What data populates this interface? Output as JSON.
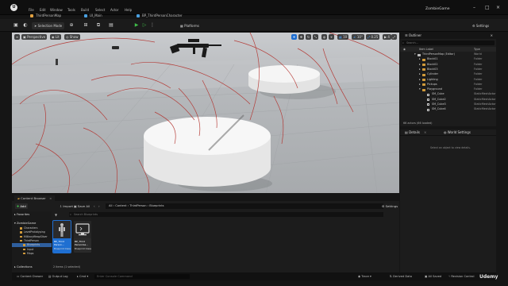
{
  "app": {
    "project_name": "ZombieGame",
    "logo_glyph": "U",
    "watermark": "Udemy"
  },
  "menu": [
    "File",
    "Edit",
    "Window",
    "Tools",
    "Build",
    "Select",
    "Actor",
    "Help"
  ],
  "tabs": [
    {
      "label": "ThirdPersonMap",
      "color": "#e0a040"
    },
    {
      "label": "UI_Main",
      "color": "#4aa0e0"
    },
    {
      "label": "BP_ThirdPersonCharacter",
      "color": "#4aa0e0"
    }
  ],
  "toolbar": {
    "selection_mode": "Selection Mode",
    "platforms": "Platforms",
    "settings": "Settings"
  },
  "viewport": {
    "perspective": "Perspective",
    "lit": "Lit",
    "show": "Show",
    "grid_snap": "10",
    "rot_snap": "10°",
    "scale_snap": "0.25",
    "cam_speed": "4"
  },
  "outliner": {
    "title": "Outliner",
    "col_label": "Item Label",
    "col_type": "Type",
    "search_placeholder": "Search...",
    "status": "66 actors (66 loaded)",
    "rows": [
      {
        "label": "ThirdPersonMap (Editor)",
        "type": "World",
        "indent": 0,
        "icon": "world"
      },
      {
        "label": "Block01",
        "type": "Folder",
        "indent": 1,
        "icon": "folder"
      },
      {
        "label": "Block02",
        "type": "Folder",
        "indent": 1,
        "icon": "folder"
      },
      {
        "label": "Block03",
        "type": "Folder",
        "indent": 1,
        "icon": "folder"
      },
      {
        "label": "Cylinder",
        "type": "Folder",
        "indent": 1,
        "icon": "folder"
      },
      {
        "label": "Lighting",
        "type": "Folder",
        "indent": 1,
        "icon": "folder"
      },
      {
        "label": "Pickups",
        "type": "Folder",
        "indent": 1,
        "icon": "folder"
      },
      {
        "label": "Playground",
        "type": "Folder",
        "indent": 1,
        "icon": "folder"
      },
      {
        "label": "SM_Cube",
        "type": "StaticMeshActor",
        "indent": 2,
        "icon": "mesh"
      },
      {
        "label": "SM_Cube2",
        "type": "StaticMeshActor",
        "indent": 2,
        "icon": "mesh"
      },
      {
        "label": "SM_Cube3",
        "type": "StaticMeshActor",
        "indent": 2,
        "icon": "mesh"
      },
      {
        "label": "SM_Cube4",
        "type": "StaticMeshActor",
        "indent": 2,
        "icon": "mesh"
      }
    ]
  },
  "details": {
    "tab_details": "Details",
    "tab_world": "World Settings",
    "empty_text": "Select an object to view details."
  },
  "content_browser": {
    "title": "Content Browser",
    "add": "Add",
    "import": "Import",
    "save_all": "Save All",
    "path": [
      "All",
      "Content",
      "ThirdPerson",
      "Blueprints"
    ],
    "settings": "Settings",
    "search_placeholder": "Search Blueprints",
    "favorites": "Favorites",
    "collections": "Collections",
    "root": "ZombieGame",
    "tree": [
      "Characters",
      "LevelPrototyping",
      "MilitaryWeapSilver",
      "ThirdPerson",
      "Blueprints",
      "Input",
      "Maps"
    ],
    "assets": [
      {
        "name": "BP_Third",
        "sub": "Person...",
        "kind": "Blueprint Class",
        "selected": true
      },
      {
        "name": "BP_Third",
        "sub": "PersonGa...",
        "kind": "Blueprint Class",
        "selected": false
      }
    ],
    "status": "2 items (1 selected)"
  },
  "statusbar": {
    "content_drawer": "Content Drawer",
    "output_log": "Output Log",
    "cmd": "Cmd",
    "cmd_placeholder": "Enter Console Command",
    "trace": "Trace",
    "derived_data": "Derived Data",
    "all_saved": "All Saved",
    "revision_control": "Revision Control"
  },
  "colors": {
    "accent": "#1f6fd1",
    "folder": "#d19a3a",
    "selected_asset": "#1f6fd1"
  }
}
